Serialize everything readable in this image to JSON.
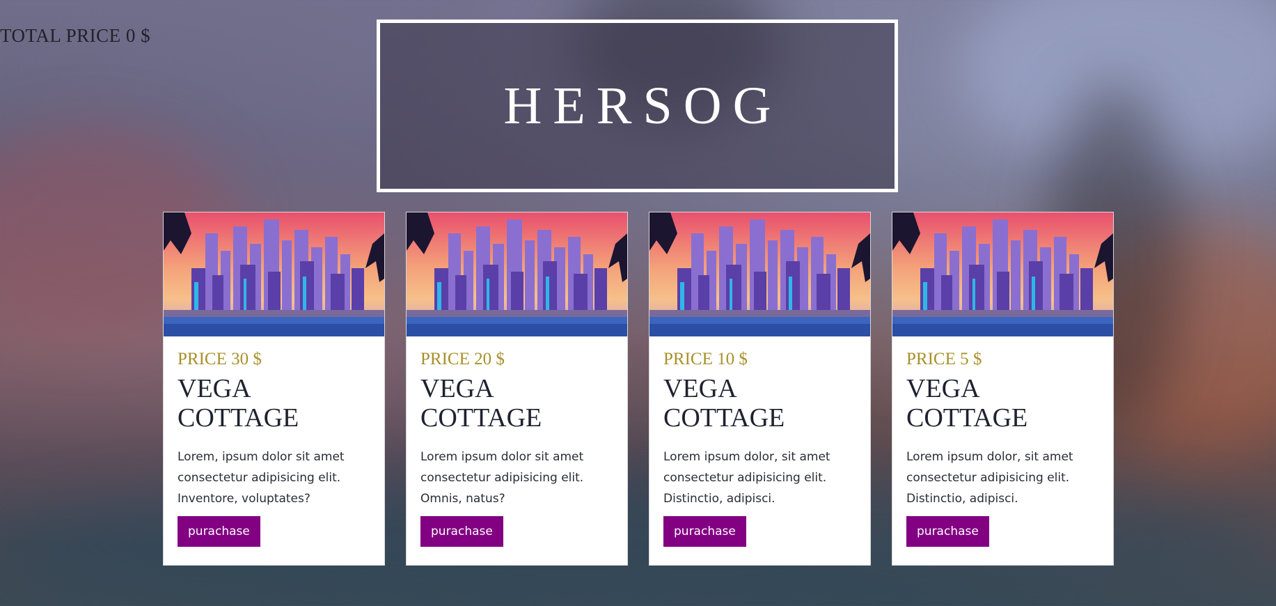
{
  "header": {
    "total_price_label": "TOTAL PRICE 0 $",
    "brand_title": "HERSOG"
  },
  "colors": {
    "price_gold": "#a8902a",
    "button_purple": "#820082",
    "title_dark": "#1e2230"
  },
  "cards": [
    {
      "price": "PRICE 30 $",
      "title": "VEGA COTTAGE",
      "description": "Lorem, ipsum dolor sit amet consectetur adipisicing elit. Inventore, voluptates?",
      "button_label": "purachase",
      "image_icon": "city-skyline-image"
    },
    {
      "price": "PRICE 20 $",
      "title": "VEGA COTTAGE",
      "description": "Lorem ipsum dolor sit amet consectetur adipisicing elit. Omnis, natus?",
      "button_label": "purachase",
      "image_icon": "city-skyline-image"
    },
    {
      "price": "PRICE 10 $",
      "title": "VEGA COTTAGE",
      "description": "Lorem ipsum dolor, sit amet consectetur adipisicing elit. Distinctio, adipisci.",
      "button_label": "purachase",
      "image_icon": "city-skyline-image"
    },
    {
      "price": "PRICE 5 $",
      "title": "VEGA COTTAGE",
      "description": "Lorem ipsum dolor, sit amet consectetur adipisicing elit. Distinctio, adipisci.",
      "button_label": "purachase",
      "image_icon": "city-skyline-image"
    }
  ]
}
